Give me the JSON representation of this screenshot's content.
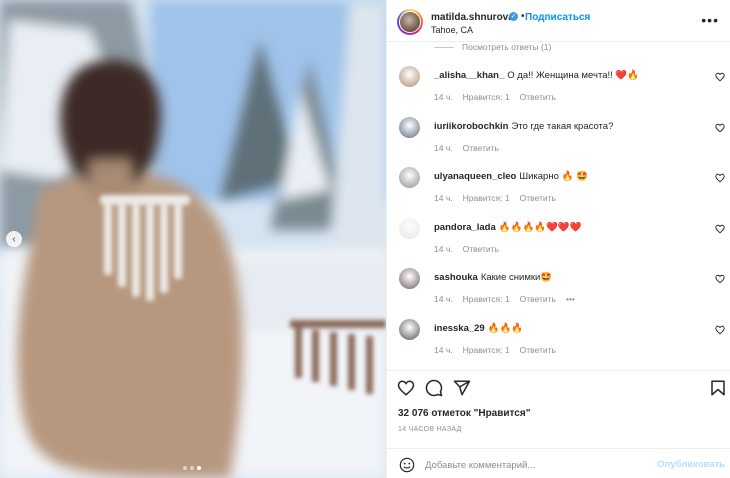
{
  "header": {
    "username": "matilda.shnurova",
    "verified_glyph": "✓",
    "separator": "•",
    "follow_label": "Подписаться",
    "location": "Tahoe, CA",
    "more_glyph": "•••"
  },
  "media": {
    "prev_glyph": "‹",
    "slide_count": 3,
    "active_slide": 3
  },
  "view_replies": "Посмотреть ответы (1)",
  "comments": [
    {
      "user": "_alisha__khan_",
      "text": "О да!! Женщина мечта!! ❤️🔥",
      "time": "14 ч.",
      "likes": "Нравится: 1",
      "reply": "Ответить",
      "more": "",
      "avatar_color": "#b08b6e"
    },
    {
      "user": "iuriikorobochkin",
      "text": "Это где такая красота?",
      "time": "14 ч.",
      "likes": "",
      "reply": "Ответить",
      "more": "",
      "avatar_color": "#5b6b80"
    },
    {
      "user": "ulyanaqueen_cleo",
      "text": "Шикарно 🔥 🤩",
      "time": "14 ч.",
      "likes": "Нравится: 1",
      "reply": "Ответить",
      "more": "",
      "avatar_color": "#8d8d8d"
    },
    {
      "user": "pandora_lada",
      "text": "🔥🔥🔥🔥❤️❤️❤️",
      "time": "14 ч.",
      "likes": "",
      "reply": "Ответить",
      "more": "",
      "avatar_color": "#e8e3e3"
    },
    {
      "user": "sashouka",
      "text": "Какие снимки🤩",
      "time": "14 ч.",
      "likes": "Нравится: 1",
      "reply": "Ответить",
      "more": "•••",
      "avatar_color": "#6e5a66"
    },
    {
      "user": "inesska_29",
      "text": "🔥🔥🔥",
      "time": "14 ч.",
      "likes": "Нравится: 1",
      "reply": "Ответить",
      "more": "",
      "avatar_color": "#4f5a52"
    }
  ],
  "footer": {
    "likes_text": "32 076 отметок \"Нравится\"",
    "time_ago": "14 ЧАСОВ НАЗАД",
    "comment_placeholder": "Добавьте комментарий...",
    "publish_label": "Опубликовать"
  },
  "icons": {
    "like": "heart-icon",
    "comment": "comment-icon",
    "share": "share-icon",
    "save": "bookmark-icon",
    "emoji": "emoji-icon"
  }
}
